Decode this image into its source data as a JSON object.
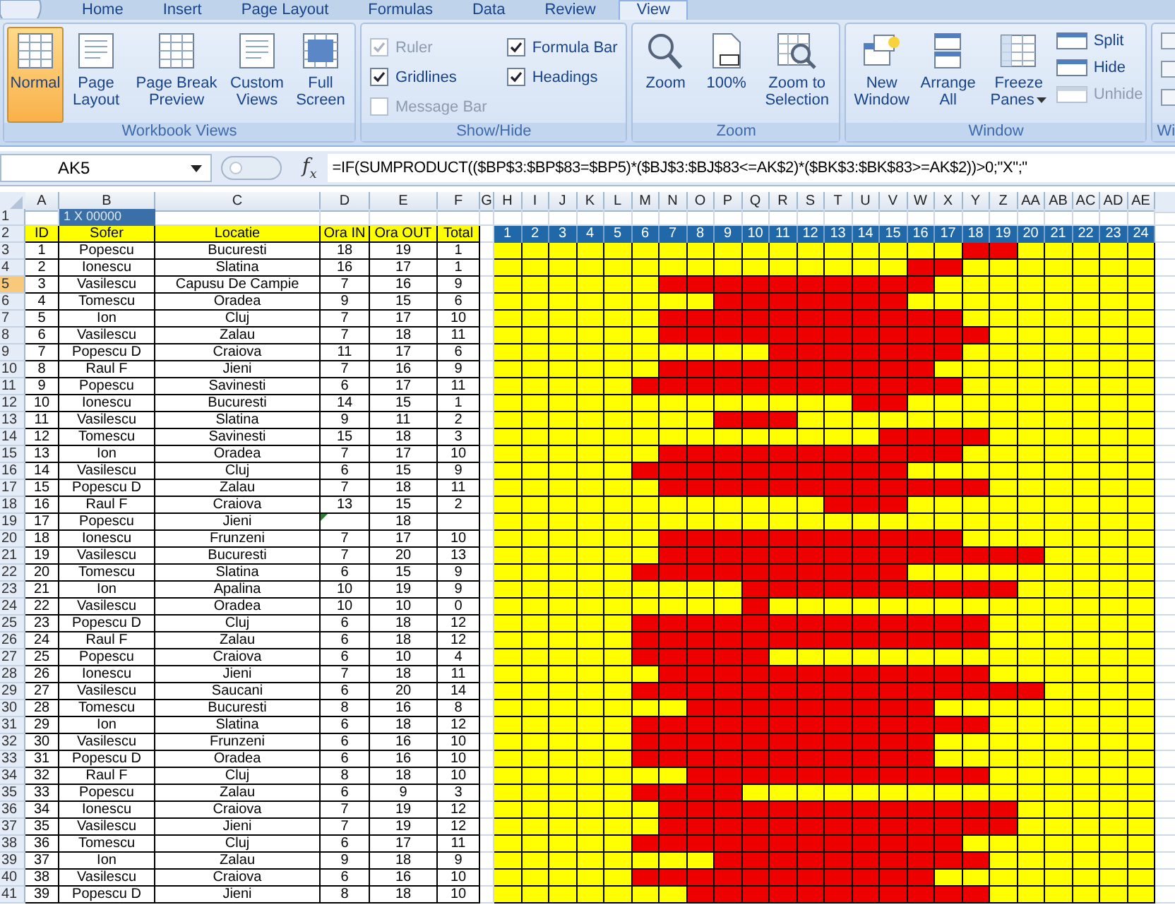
{
  "ribbon": {
    "tabs": [
      {
        "label": "Home",
        "selected": false
      },
      {
        "label": "Insert",
        "selected": false
      },
      {
        "label": "Page Layout",
        "selected": false
      },
      {
        "label": "Formulas",
        "selected": false
      },
      {
        "label": "Data",
        "selected": false
      },
      {
        "label": "Review",
        "selected": false
      },
      {
        "label": "View",
        "selected": true
      }
    ],
    "groups": [
      {
        "kind": "views",
        "label": "Workbook Views",
        "items": [
          {
            "label": "Normal",
            "selected": true
          },
          {
            "label": "Page Layout",
            "selected": false
          },
          {
            "label": "Page Break Preview",
            "selected": false
          },
          {
            "label": "Custom Views",
            "selected": false
          },
          {
            "label": "Full Screen",
            "selected": false
          }
        ]
      },
      {
        "kind": "checks",
        "label": "Show/Hide",
        "items": [
          {
            "label": "Ruler",
            "checked": true,
            "disabled": true
          },
          {
            "label": "Gridlines",
            "checked": true,
            "disabled": false
          },
          {
            "label": "Message Bar",
            "checked": false,
            "disabled": true
          },
          {
            "label": "Formula Bar",
            "checked": true,
            "disabled": false
          },
          {
            "label": "Headings",
            "checked": true,
            "disabled": false
          }
        ]
      },
      {
        "kind": "zoom",
        "label": "Zoom",
        "items": [
          {
            "label": "Zoom"
          },
          {
            "label": "100%"
          },
          {
            "label": "Zoom to Selection"
          }
        ]
      },
      {
        "kind": "window",
        "label": "Window",
        "items": [
          {
            "kind": "large",
            "label": "New Window",
            "disabled": false
          },
          {
            "kind": "large",
            "label": "Arrange All",
            "disabled": false
          },
          {
            "kind": "menu",
            "label": "Freeze Panes",
            "disabled": false
          },
          {
            "kind": "small",
            "label": "Split",
            "disabled": false
          },
          {
            "kind": "small",
            "label": "Hide",
            "disabled": false
          },
          {
            "kind": "small",
            "label": "Unhide",
            "disabled": true
          }
        ]
      },
      {
        "kind": "partial",
        "label": "Wi"
      }
    ]
  },
  "formula_bar": {
    "name_box": "AK5",
    "function_button": "f$_{x}$",
    "formula": "=IF(SUMPRODUCT(($BP$3:$BP$83=$BP5)*($BJ$3:$BJ$83<=AK$2)*($BK$3:$BK$83>=AK$2))>0;\"X\";\""
  },
  "sheet": {
    "columns": [
      "A",
      "B",
      "C",
      "D",
      "E",
      "F",
      "G",
      "H",
      "I",
      "J",
      "K",
      "L",
      "M",
      "N",
      "O",
      "P",
      "Q",
      "R",
      "S",
      "T",
      "U",
      "V",
      "W",
      "X",
      "Y",
      "Z",
      "AA",
      "AB",
      "AC",
      "AD",
      "AE"
    ],
    "row_1": {
      "number": "1",
      "cell_b": "1 X 00000"
    },
    "row_2": {
      "number": "2",
      "headers": [
        "ID",
        "Sofer",
        "Locatie",
        "Ora IN",
        "Ora OUT",
        "Total"
      ],
      "hours": [
        "1",
        "2",
        "3",
        "4",
        "5",
        "6",
        "7",
        "8",
        "9",
        "10",
        "11",
        "12",
        "13",
        "14",
        "15",
        "16",
        "17",
        "18",
        "19",
        "20",
        "21",
        "22",
        "23",
        "24"
      ]
    },
    "rows": [
      {
        "number": "3",
        "id": "1",
        "sofer": "Popescu",
        "locatie": "Bucuresti",
        "ora_in": "18",
        "ora_out": "19",
        "total": "1",
        "selected": false,
        "error": false
      },
      {
        "number": "4",
        "id": "2",
        "sofer": "Ionescu",
        "locatie": "Slatina",
        "ora_in": "16",
        "ora_out": "17",
        "total": "1",
        "selected": false,
        "error": false
      },
      {
        "number": "5",
        "id": "3",
        "sofer": "Vasilescu",
        "locatie": "Capusu De Campie",
        "ora_in": "7",
        "ora_out": "16",
        "total": "9",
        "selected": true,
        "error": false
      },
      {
        "number": "6",
        "id": "4",
        "sofer": "Tomescu",
        "locatie": "Oradea",
        "ora_in": "9",
        "ora_out": "15",
        "total": "6",
        "selected": false,
        "error": false
      },
      {
        "number": "7",
        "id": "5",
        "sofer": "Ion",
        "locatie": "Cluj",
        "ora_in": "7",
        "ora_out": "17",
        "total": "10",
        "selected": false,
        "error": false
      },
      {
        "number": "8",
        "id": "6",
        "sofer": "Vasilescu",
        "locatie": "Zalau",
        "ora_in": "7",
        "ora_out": "18",
        "total": "11",
        "selected": false,
        "error": false
      },
      {
        "number": "9",
        "id": "7",
        "sofer": "Popescu D",
        "locatie": "Craiova",
        "ora_in": "11",
        "ora_out": "17",
        "total": "6",
        "selected": false,
        "error": false
      },
      {
        "number": "10",
        "id": "8",
        "sofer": "Raul F",
        "locatie": "Jieni",
        "ora_in": "7",
        "ora_out": "16",
        "total": "9",
        "selected": false,
        "error": false
      },
      {
        "number": "11",
        "id": "9",
        "sofer": "Popescu",
        "locatie": "Savinesti",
        "ora_in": "6",
        "ora_out": "17",
        "total": "11",
        "selected": false,
        "error": false
      },
      {
        "number": "12",
        "id": "10",
        "sofer": "Ionescu",
        "locatie": "Bucuresti",
        "ora_in": "14",
        "ora_out": "15",
        "total": "1",
        "selected": false,
        "error": false
      },
      {
        "number": "13",
        "id": "11",
        "sofer": "Vasilescu",
        "locatie": "Slatina",
        "ora_in": "9",
        "ora_out": "11",
        "total": "2",
        "selected": false,
        "error": false
      },
      {
        "number": "14",
        "id": "12",
        "sofer": "Tomescu",
        "locatie": "Savinesti",
        "ora_in": "15",
        "ora_out": "18",
        "total": "3",
        "selected": false,
        "error": false
      },
      {
        "number": "15",
        "id": "13",
        "sofer": "Ion",
        "locatie": "Oradea",
        "ora_in": "7",
        "ora_out": "17",
        "total": "10",
        "selected": false,
        "error": false
      },
      {
        "number": "16",
        "id": "14",
        "sofer": "Vasilescu",
        "locatie": "Cluj",
        "ora_in": "6",
        "ora_out": "15",
        "total": "9",
        "selected": false,
        "error": false
      },
      {
        "number": "17",
        "id": "15",
        "sofer": "Popescu D",
        "locatie": "Zalau",
        "ora_in": "7",
        "ora_out": "18",
        "total": "11",
        "selected": false,
        "error": false
      },
      {
        "number": "18",
        "id": "16",
        "sofer": "Raul F",
        "locatie": "Craiova",
        "ora_in": "13",
        "ora_out": "15",
        "total": "2",
        "selected": false,
        "error": false
      },
      {
        "number": "19",
        "id": "17",
        "sofer": "Popescu",
        "locatie": "Jieni",
        "ora_out": "18",
        "selected": false,
        "error": true
      },
      {
        "number": "20",
        "id": "18",
        "sofer": "Ionescu",
        "locatie": "Frunzeni",
        "ora_in": "7",
        "ora_out": "17",
        "total": "10",
        "selected": false,
        "error": false
      },
      {
        "number": "21",
        "id": "19",
        "sofer": "Vasilescu",
        "locatie": "Bucuresti",
        "ora_in": "7",
        "ora_out": "20",
        "total": "13",
        "selected": false,
        "error": false
      },
      {
        "number": "22",
        "id": "20",
        "sofer": "Tomescu",
        "locatie": "Slatina",
        "ora_in": "6",
        "ora_out": "15",
        "total": "9",
        "selected": false,
        "error": false
      },
      {
        "number": "23",
        "id": "21",
        "sofer": "Ion",
        "locatie": "Apalina",
        "ora_in": "10",
        "ora_out": "19",
        "total": "9",
        "selected": false,
        "error": false
      },
      {
        "number": "24",
        "id": "22",
        "sofer": "Vasilescu",
        "locatie": "Oradea",
        "ora_in": "10",
        "ora_out": "10",
        "total": "0",
        "selected": false,
        "error": false
      },
      {
        "number": "25",
        "id": "23",
        "sofer": "Popescu D",
        "locatie": "Cluj",
        "ora_in": "6",
        "ora_out": "18",
        "total": "12",
        "selected": false,
        "error": false
      },
      {
        "number": "26",
        "id": "24",
        "sofer": "Raul F",
        "locatie": "Zalau",
        "ora_in": "6",
        "ora_out": "18",
        "total": "12",
        "selected": false,
        "error": false
      },
      {
        "number": "27",
        "id": "25",
        "sofer": "Popescu",
        "locatie": "Craiova",
        "ora_in": "6",
        "ora_out": "10",
        "total": "4",
        "selected": false,
        "error": false
      },
      {
        "number": "28",
        "id": "26",
        "sofer": "Ionescu",
        "locatie": "Jieni",
        "ora_in": "7",
        "ora_out": "18",
        "total": "11",
        "selected": false,
        "error": false
      },
      {
        "number": "29",
        "id": "27",
        "sofer": "Vasilescu",
        "locatie": "Saucani",
        "ora_in": "6",
        "ora_out": "20",
        "total": "14",
        "selected": false,
        "error": false
      },
      {
        "number": "30",
        "id": "28",
        "sofer": "Tomescu",
        "locatie": "Bucuresti",
        "ora_in": "8",
        "ora_out": "16",
        "total": "8",
        "selected": false,
        "error": false
      },
      {
        "number": "31",
        "id": "29",
        "sofer": "Ion",
        "locatie": "Slatina",
        "ora_in": "6",
        "ora_out": "18",
        "total": "12",
        "selected": false,
        "error": false
      },
      {
        "number": "32",
        "id": "30",
        "sofer": "Vasilescu",
        "locatie": "Frunzeni",
        "ora_in": "6",
        "ora_out": "16",
        "total": "10",
        "selected": false,
        "error": false
      },
      {
        "number": "33",
        "id": "31",
        "sofer": "Popescu D",
        "locatie": "Oradea",
        "ora_in": "6",
        "ora_out": "16",
        "total": "10",
        "selected": false,
        "error": false
      },
      {
        "number": "34",
        "id": "32",
        "sofer": "Raul F",
        "locatie": "Cluj",
        "ora_in": "8",
        "ora_out": "18",
        "total": "10",
        "selected": false,
        "error": false
      },
      {
        "number": "35",
        "id": "33",
        "sofer": "Popescu",
        "locatie": "Zalau",
        "ora_in": "6",
        "ora_out": "9",
        "total": "3",
        "selected": false,
        "error": false
      },
      {
        "number": "36",
        "id": "34",
        "sofer": "Ionescu",
        "locatie": "Craiova",
        "ora_in": "7",
        "ora_out": "19",
        "total": "12",
        "selected": false,
        "error": false
      },
      {
        "number": "37",
        "id": "35",
        "sofer": "Vasilescu",
        "locatie": "Jieni",
        "ora_in": "7",
        "ora_out": "19",
        "total": "12",
        "selected": false,
        "error": false
      },
      {
        "number": "38",
        "id": "36",
        "sofer": "Tomescu",
        "locatie": "Cluj",
        "ora_in": "6",
        "ora_out": "17",
        "total": "11",
        "selected": false,
        "error": false
      },
      {
        "number": "39",
        "id": "37",
        "sofer": "Ion",
        "locatie": "Zalau",
        "ora_in": "9",
        "ora_out": "18",
        "total": "9",
        "selected": false,
        "error": false
      },
      {
        "number": "40",
        "id": "38",
        "sofer": "Vasilescu",
        "locatie": "Craiova",
        "ora_in": "6",
        "ora_out": "16",
        "total": "10",
        "selected": false,
        "error": false
      },
      {
        "number": "41",
        "id": "39",
        "sofer": "Popescu D",
        "locatie": "Jieni",
        "ora_in": "8",
        "ora_out": "18",
        "total": "10",
        "selected": false,
        "error": false
      }
    ]
  }
}
